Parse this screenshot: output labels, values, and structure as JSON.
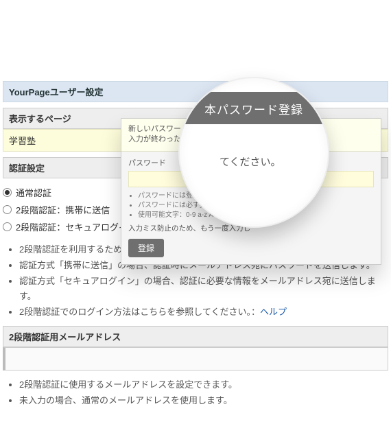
{
  "pageTitle": "YourPageユーザー設定",
  "sections": {
    "displayPage": {
      "header": "表示するページ",
      "value": "学習塾"
    },
    "auth": {
      "header": "認証設定",
      "options": [
        {
          "label": "通常認証",
          "checked": true
        },
        {
          "label": "2段階認証：携帯に送信",
          "checked": false
        },
        {
          "label": "2段階認証：セキュアログイン",
          "checked": false
        }
      ],
      "notes": [
        "2段階認証を利用するためには外部送信メールアドレスの登録が必要になります。",
        "認証方式「携帯に送信」の場合、認証時にメールアドレス宛にパスワードを送信します。",
        "認証方式「セキュアログイン」の場合、認証に必要な情報をメールアドレス宛に送信します。"
      ],
      "helpPrefix": "2段階認証でのログイン方法はこちらを参照してください。：",
      "helpLink": "ヘルプ"
    },
    "mail": {
      "header": "2段階認証用メールアドレス",
      "notes": [
        "2段階認証に使用するメールアドレスを設定できます。",
        "未入力の場合、通常のメールアドレスを使用します。"
      ]
    }
  },
  "panel": {
    "intro1": "新しいパスワードを2回入力し",
    "intro2": "入力が終わったら下の「登録",
    "fieldLabel": "パスワード",
    "fieldPlaceholder": "てください。",
    "hints": [
      "パスワードには登録可能な文",
      "パスワードには必ず英字（小",
      "使用可能文字：0-9 a-z A-Z _"
    ],
    "retypeNote": "入力ミス防止のため、もう一度入力し",
    "button": "登録"
  },
  "lens": {
    "title": "本パスワード登録",
    "placeholder": "てください。"
  }
}
